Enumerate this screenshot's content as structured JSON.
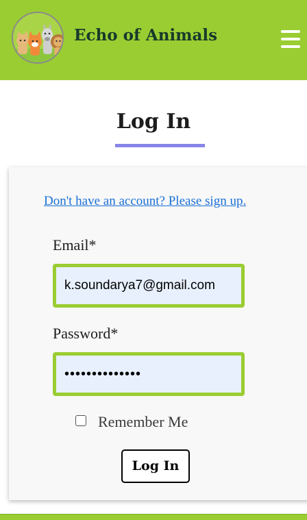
{
  "header": {
    "brand_name": "Echo of Animals",
    "logo_icon": "animals-logo-icon",
    "menu_icon": "hamburger-menu-icon",
    "background_color": "#9acd32"
  },
  "page": {
    "title": "Log In",
    "underline_color": "#8585e8"
  },
  "form": {
    "signup_link": "Don't have an account? Please sign up.",
    "email_label": "Email*",
    "email_value": "k.soundarya7@gmail.com",
    "password_label": "Password*",
    "password_masked": "••••••••••••••",
    "remember_label": "Remember Me",
    "remember_checked": false,
    "submit_label": "Log In",
    "input_border_color": "#9acd32",
    "link_color": "#1a6fd6"
  }
}
